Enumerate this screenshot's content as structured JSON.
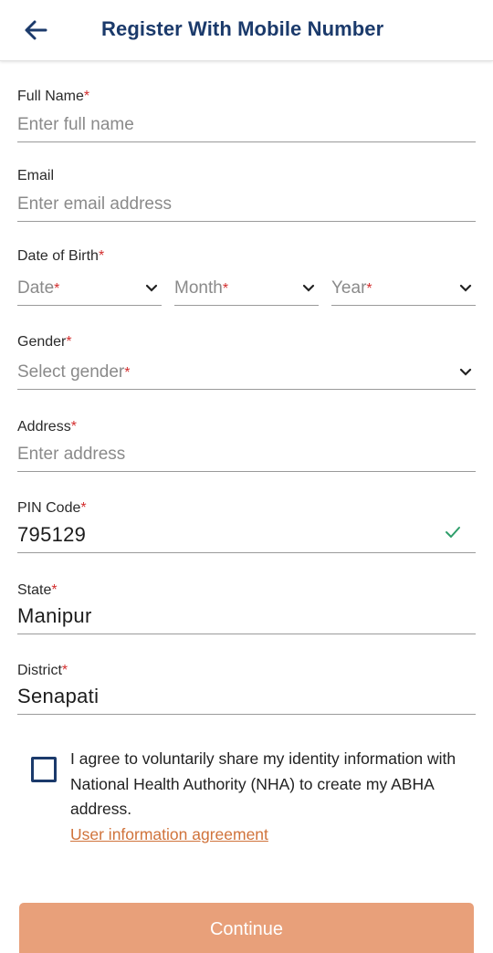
{
  "header": {
    "title": "Register With Mobile Number",
    "back_icon": "arrow-left-icon"
  },
  "fields": {
    "full_name": {
      "label": "Full Name",
      "required": "*",
      "placeholder": "Enter full name"
    },
    "email": {
      "label": "Email",
      "placeholder": "Enter email address"
    },
    "dob": {
      "label": "Date of Birth",
      "required": "*",
      "date": "Date",
      "month": "Month",
      "year": "Year",
      "star": "*"
    },
    "gender": {
      "label": "Gender",
      "required": "*",
      "placeholder": "Select gender",
      "star": "*"
    },
    "address": {
      "label": "Address",
      "required": "*",
      "placeholder": "Enter address"
    },
    "pin": {
      "label": "PIN Code",
      "required": "*",
      "value": "795129",
      "valid_icon": "checkmark-icon"
    },
    "state": {
      "label": "State",
      "required": "*",
      "value": "Manipur"
    },
    "district": {
      "label": "District",
      "required": "*",
      "value": "Senapati"
    }
  },
  "consent": {
    "text": "I agree to voluntarily share my identity information with National Health Authority (NHA) to create my ABHA address.",
    "link": "User information agreement",
    "checked": false
  },
  "continue_label": "Continue",
  "colors": {
    "primary": "#1b3a6b",
    "required": "#d32f2f",
    "link": "#d0733b",
    "button": "#e8a07a",
    "valid": "#2e9e6a"
  }
}
